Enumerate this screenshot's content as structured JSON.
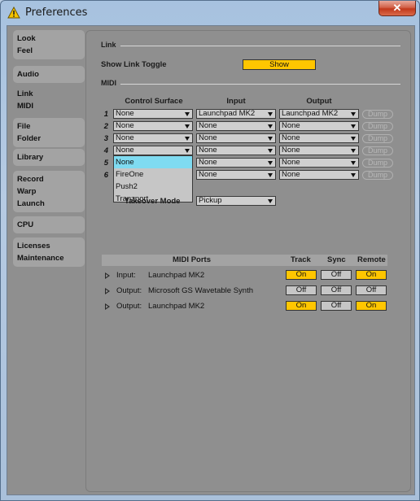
{
  "window": {
    "title": "Preferences",
    "close_glyph": "✕",
    "icon": "warning-icon"
  },
  "sidebar": {
    "groups": [
      {
        "items": [
          "Look",
          "Feel"
        ]
      },
      {
        "items": [
          "Audio"
        ]
      },
      {
        "items": [
          "Link",
          "MIDI"
        ],
        "active": true
      },
      {
        "items": [
          "File",
          "Folder"
        ]
      },
      {
        "items": [
          "Library"
        ]
      },
      {
        "items": [
          "Record",
          "Warp",
          "Launch"
        ]
      },
      {
        "items": [
          "CPU"
        ]
      },
      {
        "items": [
          "Licenses",
          "Maintenance"
        ]
      }
    ]
  },
  "link": {
    "heading": "Link",
    "show_toggle_label": "Show Link Toggle",
    "show_button": "Show"
  },
  "midi": {
    "heading": "MIDI",
    "columns": {
      "control_surface": "Control Surface",
      "input": "Input",
      "output": "Output"
    },
    "rows": [
      {
        "num": "1",
        "surface": "None",
        "input": "Launchpad MK2",
        "output": "Launchpad MK2",
        "dump": "Dump"
      },
      {
        "num": "2",
        "surface": "None",
        "input": "None",
        "output": "None",
        "dump": "Dump"
      },
      {
        "num": "3",
        "surface": "None",
        "input": "None",
        "output": "None",
        "dump": "Dump"
      },
      {
        "num": "4",
        "surface": "None",
        "input": "None",
        "output": "None",
        "dump": "Dump"
      },
      {
        "num": "5",
        "surface": "None",
        "input": "None",
        "output": "None",
        "dump": "Dump"
      },
      {
        "num": "6",
        "surface": "None",
        "input": "None",
        "output": "None",
        "dump": "Dump"
      }
    ],
    "surface_popup": [
      "None",
      "FireOne",
      "Push2",
      "Tranzport"
    ],
    "takeover_label": "Takeover Mode",
    "takeover_value": "Pickup"
  },
  "ports": {
    "headers": {
      "ports": "MIDI Ports",
      "track": "Track",
      "sync": "Sync",
      "remote": "Remote"
    },
    "rows": [
      {
        "dir": "Input:",
        "name": "Launchpad MK2",
        "track": "On",
        "sync": "Off",
        "remote": "On"
      },
      {
        "dir": "Output:",
        "name": "Microsoft GS Wavetable Synth",
        "track": "Off",
        "sync": "Off",
        "remote": "Off"
      },
      {
        "dir": "Output:",
        "name": "Launchpad MK2",
        "track": "On",
        "sync": "Off",
        "remote": "On"
      }
    ]
  },
  "colors": {
    "accent": "#ffc600",
    "selection": "#7fdbf1",
    "panel": "#8f8f8f"
  }
}
